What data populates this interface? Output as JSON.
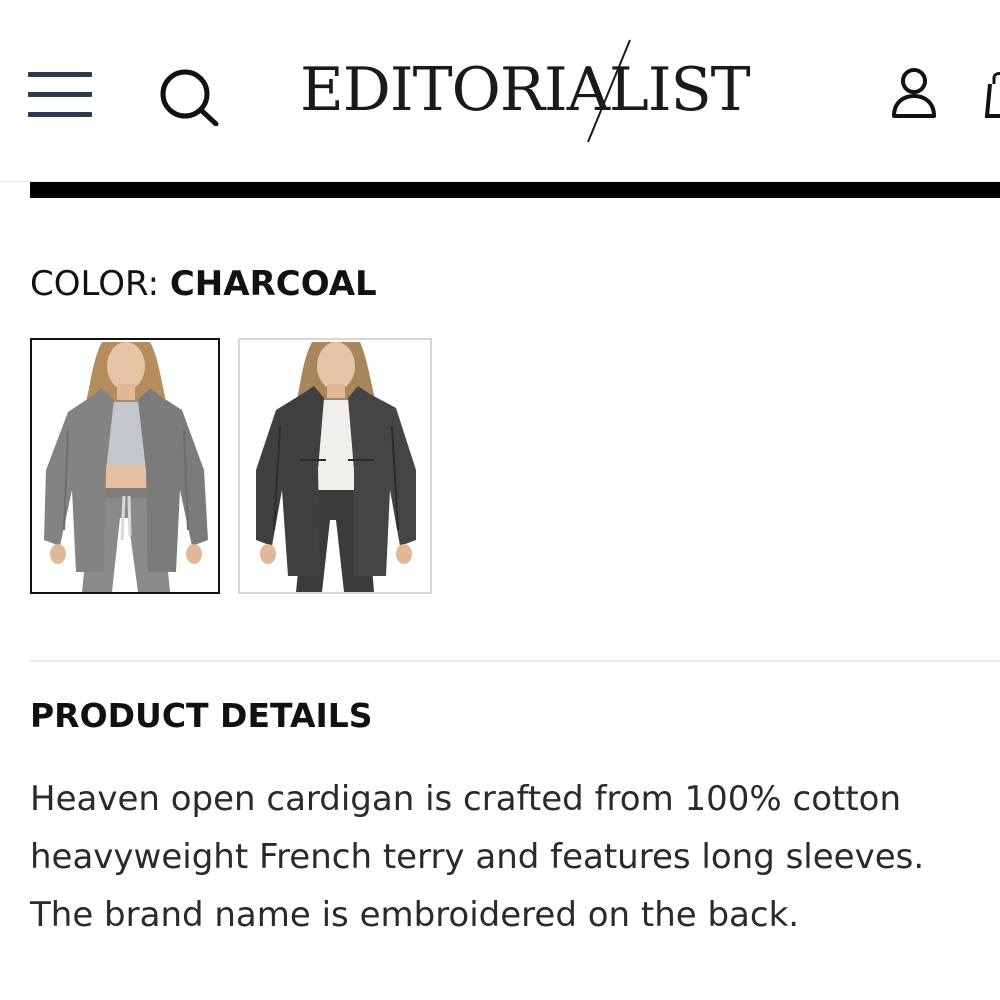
{
  "header": {
    "logo_text": "EDITORIALIST",
    "menu_icon": "hamburger-menu-icon",
    "search_icon": "search-icon",
    "account_icon": "user-icon",
    "bag_icon": "shopping-bag-icon"
  },
  "color_selector": {
    "label": "COLOR: ",
    "selected_value": "CHARCOAL",
    "swatches": [
      {
        "name": "Light Grey",
        "selected": true
      },
      {
        "name": "Charcoal",
        "selected": false
      }
    ]
  },
  "product_details": {
    "heading": "PRODUCT DETAILS",
    "description": "Heaven open cardigan is crafted from 100% cotton heavyweight French terry and features long sleeves. The brand name is embroidered on the back."
  },
  "colors": {
    "menu_bar": "#2b3b4b",
    "rule": "#000000",
    "text": "#111111"
  }
}
